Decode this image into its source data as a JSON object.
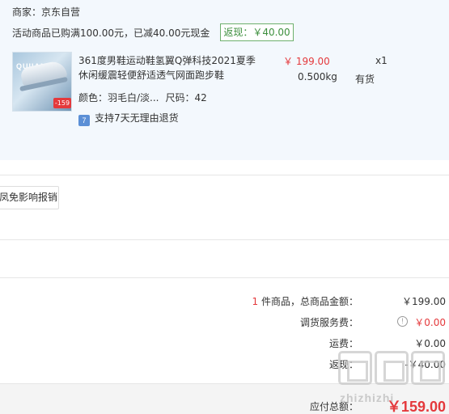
{
  "order": {
    "merchant": "商家：京东自营",
    "promo": "活动商品已购满100.00元，已减40.00元现金",
    "rebate_badge": "返现：￥40.00",
    "item": {
      "thumbnail_brand": "QUIIAM",
      "thumbnail_price_tag": "-159",
      "title": "361度男鞋运动鞋氢翼Q弹科技2021夏季休闲缓震轻便舒适透气网面跑步鞋",
      "price": "￥ 199.00",
      "weight": "0.500kg",
      "quantity": "x1",
      "stock": "有货",
      "color": "颜色：羽毛白/淡...",
      "size": "尺码：42",
      "returns_icon": "7",
      "returns": "支持7天无理由退货"
    }
  },
  "inspect_button": "凤免影响报销",
  "summary": {
    "count": "1",
    "count_suffix": " 件商品，总商品金额：",
    "goods_total": "￥199.00",
    "swap_fee_label": "调货服务费：",
    "swap_fee": "￥0.00",
    "shipping_label": "运费：",
    "shipping": "￥0.00",
    "rebate_label": "返现：",
    "rebate": "-￥40.00",
    "payable_label": "应付总额：",
    "payable": "￥159.00"
  },
  "watermark_text": "zhizhizhi"
}
